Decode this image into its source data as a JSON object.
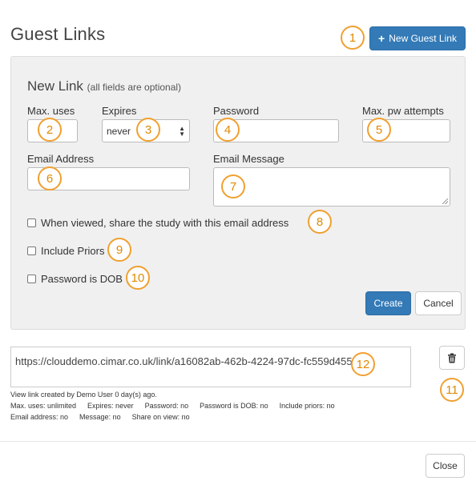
{
  "header": {
    "title": "Guest Links",
    "new_link_label": "New Guest Link"
  },
  "form": {
    "heading": "New Link",
    "heading_note": "(all fields are optional)",
    "max_uses_label": "Max. uses",
    "max_uses_value": "",
    "expires_label": "Expires",
    "expires_value": "never",
    "password_label": "Password",
    "password_value": "",
    "max_pw_label": "Max. pw attempts",
    "max_pw_value": "",
    "email_label": "Email Address",
    "email_value": "",
    "message_label": "Email Message",
    "message_value": "",
    "share_label": "When viewed, share the study with this email address",
    "priors_label": "Include Priors",
    "dob_label": "Password is DOB",
    "create_label": "Create",
    "cancel_label": "Cancel"
  },
  "link": {
    "url": "https://clouddemo.cimar.co.uk/link/a16082ab-462b-4224-97dc-fc559d4557c7",
    "created": "View link created by Demo User 0 day(s) ago.",
    "details_row1": [
      "Max. uses: unlimited",
      "Expires: never",
      "Password: no",
      "Password is DOB: no",
      "Include priors: no"
    ],
    "details_row2": [
      "Email address: no",
      "Message: no",
      "Share on view: no"
    ]
  },
  "footer": {
    "close_label": "Close"
  },
  "annotations": [
    "1",
    "2",
    "3",
    "4",
    "5",
    "6",
    "7",
    "8",
    "9",
    "10",
    "11",
    "12"
  ],
  "icons": {
    "new_link": "plus-icon",
    "delete": "trash-icon"
  },
  "colors": {
    "primary": "#337ab7",
    "badge": "#f0a030",
    "panel": "#f0f0f0"
  }
}
